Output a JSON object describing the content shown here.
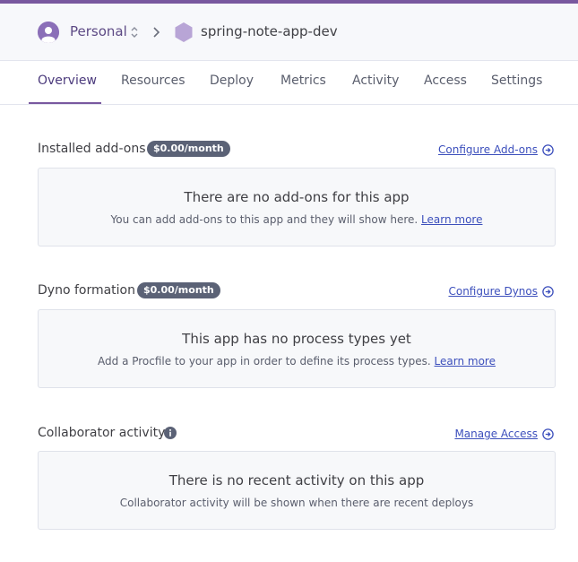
{
  "colors": {
    "accent": "#79589f",
    "link": "#3c4fbc",
    "badge": "#5b6276"
  },
  "header": {
    "account": "Personal",
    "account_icon": "user-avatar-icon",
    "app_name": "spring-note-app-dev",
    "app_icon": "hexagon-icon"
  },
  "tabs": [
    {
      "label": "Overview",
      "active": true
    },
    {
      "label": "Resources"
    },
    {
      "label": "Deploy"
    },
    {
      "label": "Metrics"
    },
    {
      "label": "Activity"
    },
    {
      "label": "Access"
    },
    {
      "label": "Settings"
    }
  ],
  "sections": {
    "addons": {
      "title": "Installed add-ons",
      "price": "$0.00/month",
      "action": "Configure Add-ons",
      "empty_title": "There are no add-ons for this app",
      "empty_desc": "You can add add-ons to this app and they will show here.",
      "learn_more": "Learn more"
    },
    "dynos": {
      "title": "Dyno formation",
      "price": "$0.00/month",
      "action": "Configure Dynos",
      "empty_title": "This app has no process types yet",
      "empty_desc": "Add a Procfile to your app in order to define its process types.",
      "learn_more": "Learn more"
    },
    "activity": {
      "title": "Collaborator activity",
      "action": "Manage Access",
      "empty_title": "There is no recent activity on this app",
      "empty_desc": "Collaborator activity will be shown when there are recent deploys"
    }
  }
}
